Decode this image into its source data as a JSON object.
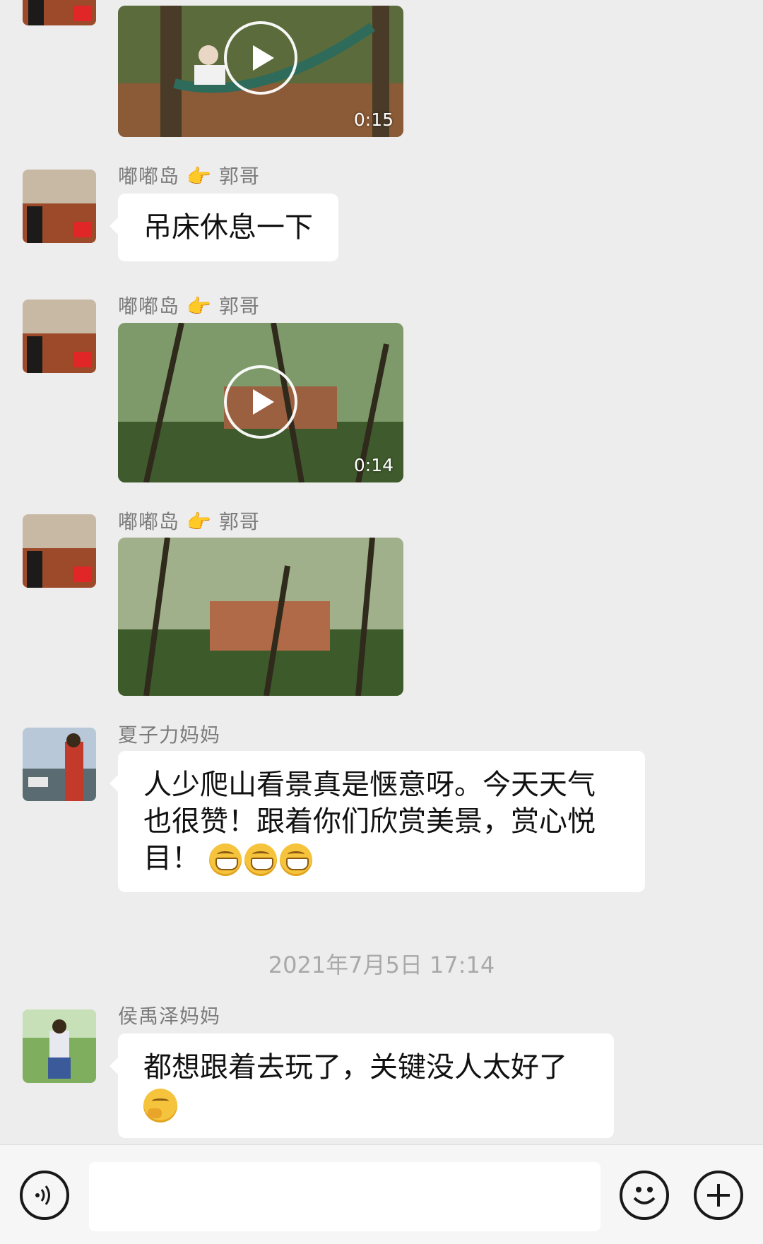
{
  "messages": {
    "video1": {
      "duration": "0:15"
    },
    "m1": {
      "sender": "嘟嘟岛",
      "sender_arrow": "👉",
      "sender_to": "郭哥",
      "text": "吊床休息一下"
    },
    "m2": {
      "sender": "嘟嘟岛",
      "sender_arrow": "👉",
      "sender_to": "郭哥",
      "duration": "0:14"
    },
    "m3": {
      "sender": "嘟嘟岛",
      "sender_arrow": "👉",
      "sender_to": "郭哥"
    },
    "m4": {
      "sender": "夏子力妈妈",
      "line1": "人少爬山看景真是惬意呀。今天天气",
      "line2": "也很赞！跟着你们欣赏美景，赏心悦",
      "line3": "目！"
    },
    "timestamp": "2021年7月5日 17:14",
    "m5": {
      "sender": "侯禹泽妈妈",
      "line1": "都想跟着去玩了，关键没人太好了"
    }
  },
  "icons": {
    "voice": "voice-icon",
    "emoji": "emoji-icon",
    "plus": "plus-icon",
    "grin": "grinning-face-emoji",
    "think": "thinking-face-emoji",
    "flag": "china-flag-badge"
  },
  "colors": {
    "background": "#ededed",
    "bubble": "#ffffff",
    "sender": "#7b7b7b",
    "timestamp": "#a9a9a9"
  }
}
